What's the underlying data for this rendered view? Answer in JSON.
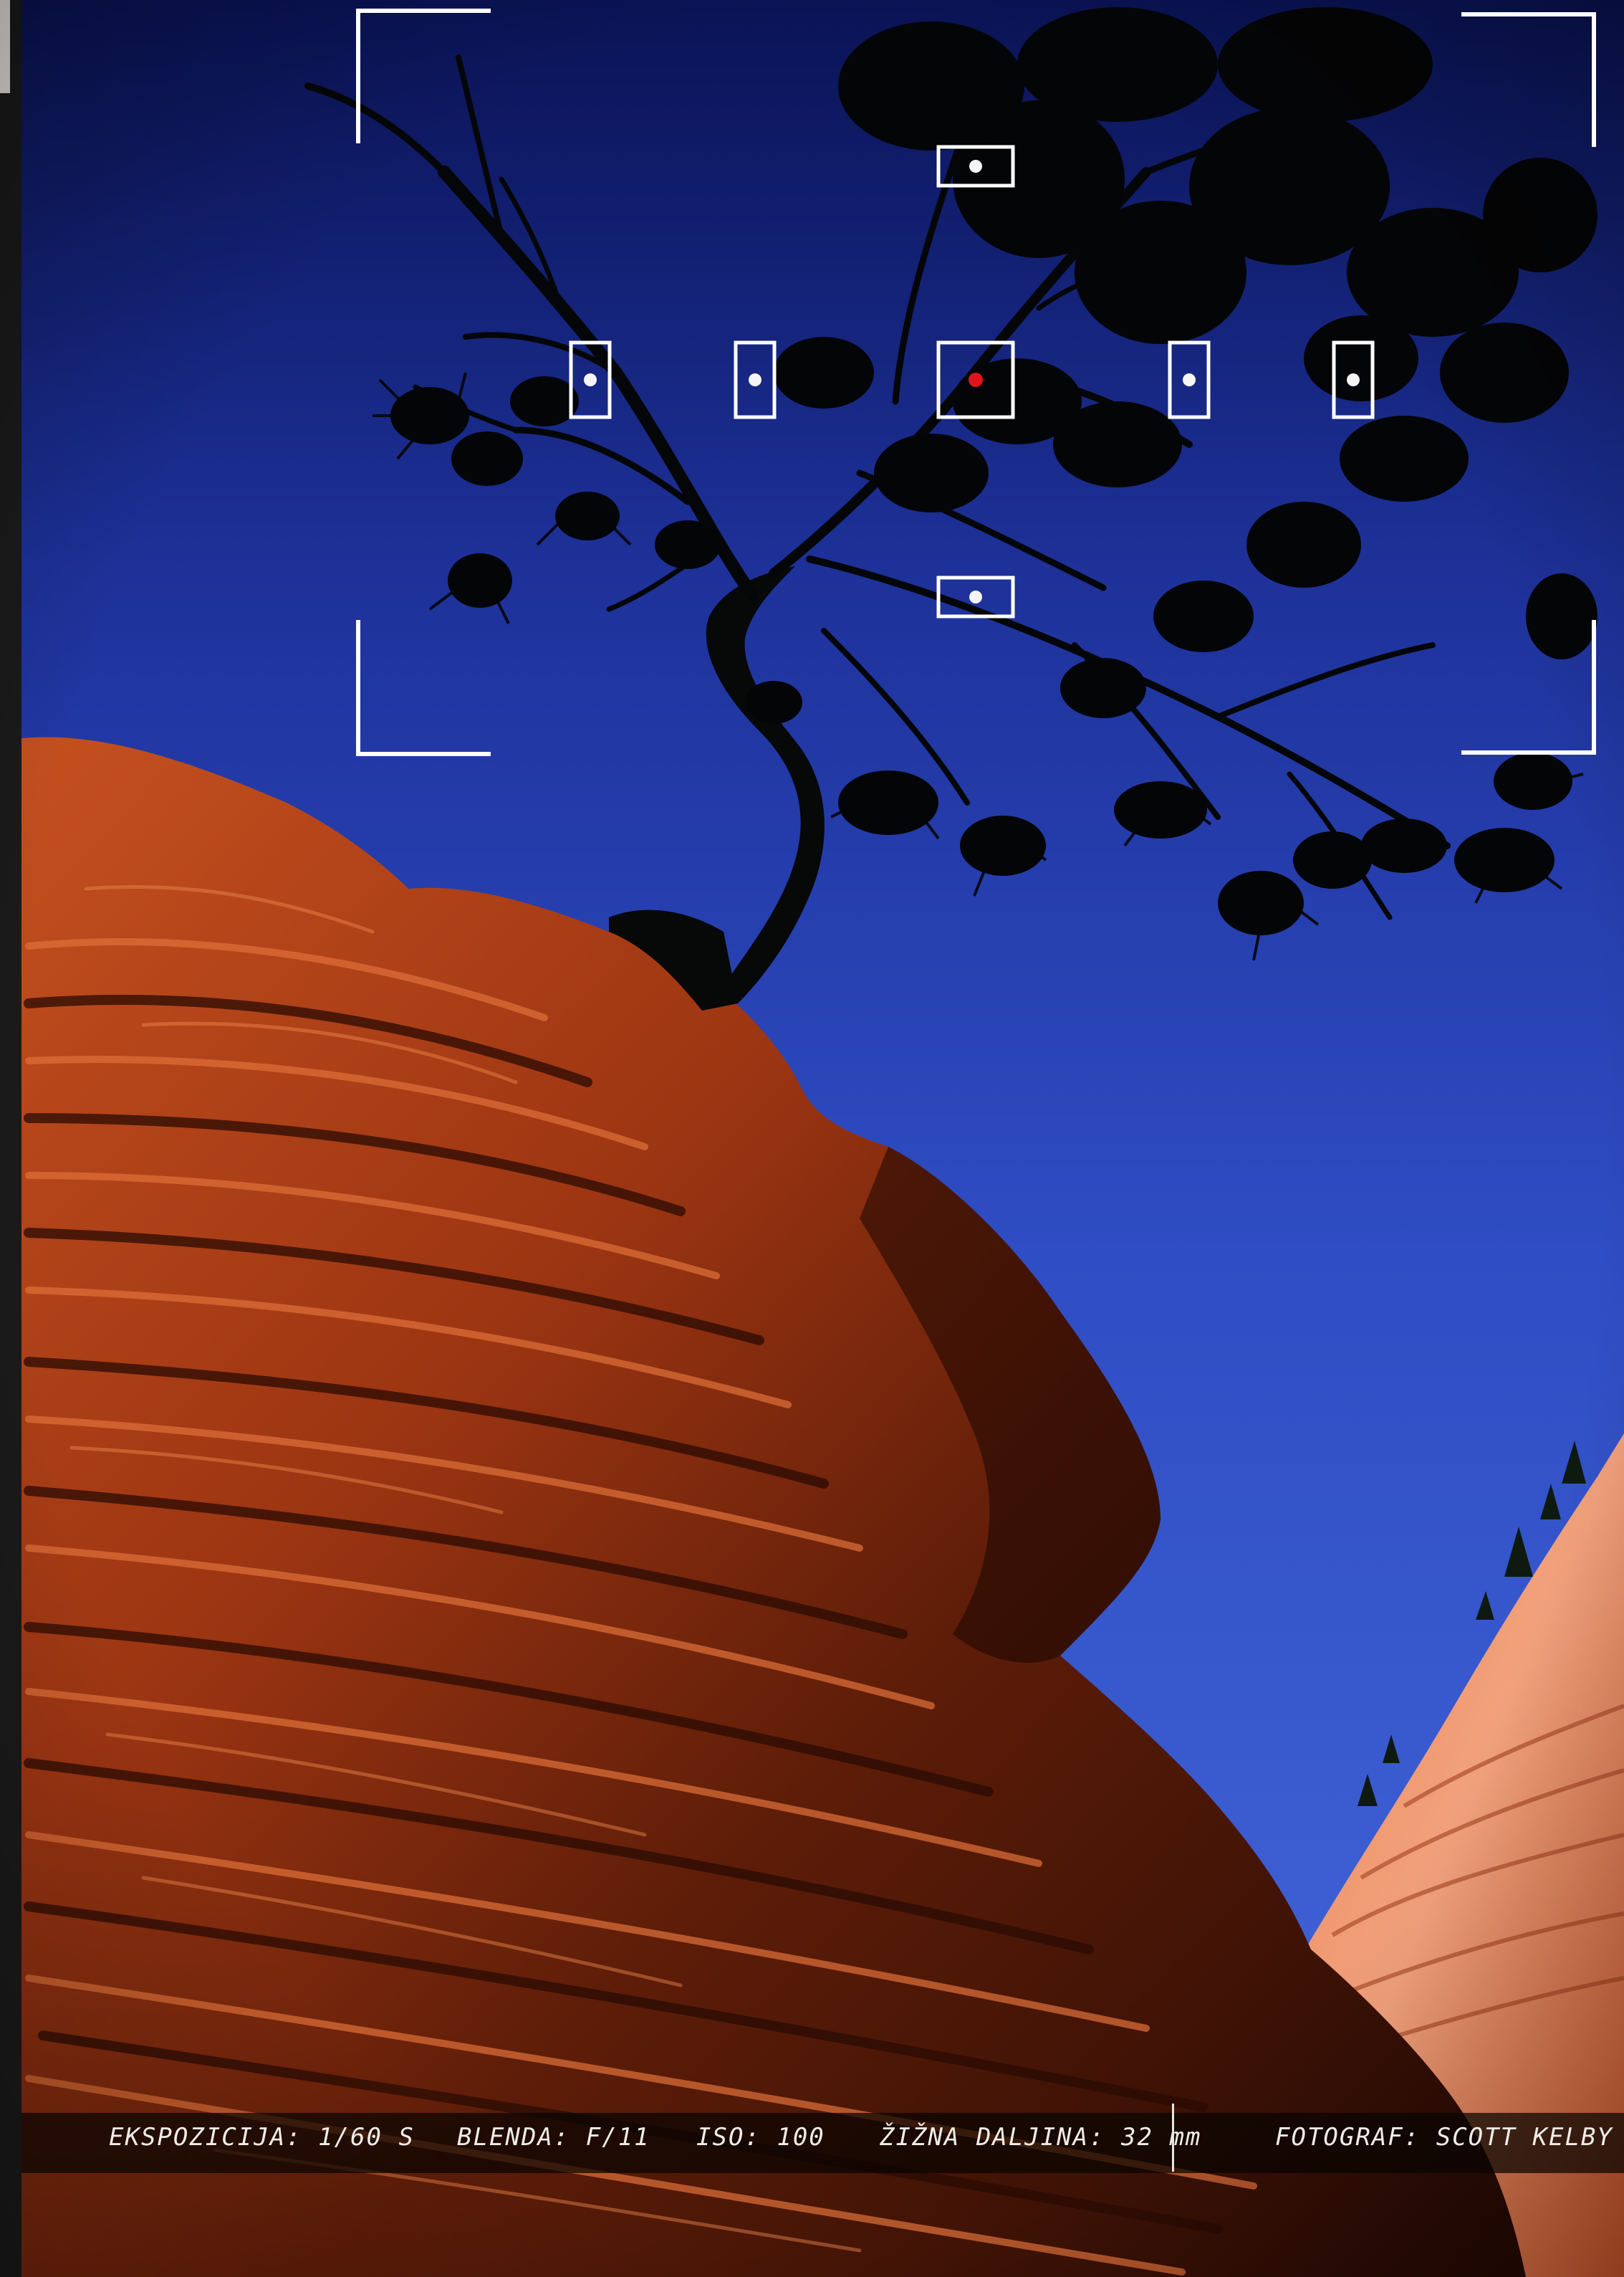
{
  "viewfinder": {
    "focus_points": {
      "count": 7,
      "active": "center",
      "active_color": "#e0141b",
      "frame_color": "#ffffff"
    }
  },
  "exposure_info": {
    "exposure": "EKSPOZICIJA: 1/60 S",
    "aperture": "BLENDA: F/11",
    "iso": "ISO: 100",
    "focal_length": "ŽIŽNA DALJINA: 32 mm",
    "photographer": "FOTOGRAF: SCOTT KELBY"
  },
  "colors": {
    "sky_top": "#0e1a6e",
    "sky_bottom": "#3e5fd0",
    "rock": "#c0451c",
    "rock_shadow": "#2a0c04",
    "tree": "#050708"
  }
}
